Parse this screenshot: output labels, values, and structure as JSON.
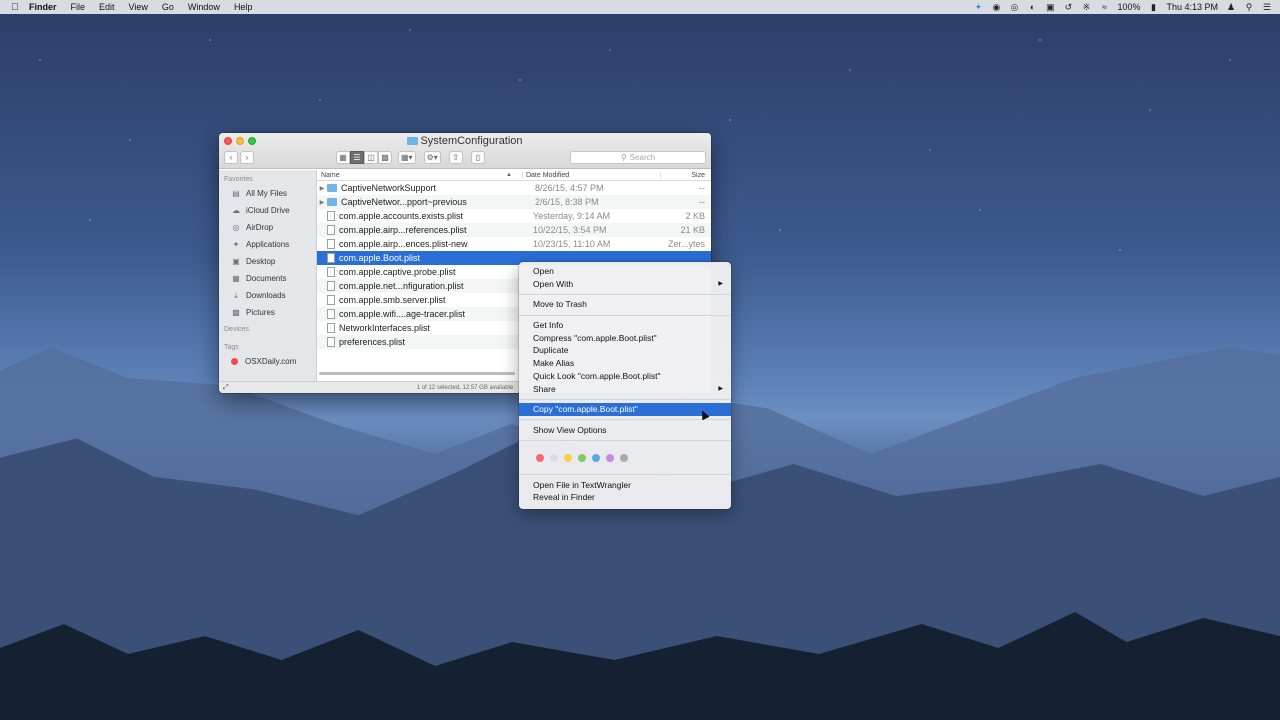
{
  "menubar": {
    "apple_icon": "apple-logo-icon",
    "items": [
      "Finder",
      "File",
      "Edit",
      "View",
      "Go",
      "Window",
      "Help"
    ],
    "status": {
      "battery": "100%",
      "clock": "Thu 4:13 PM"
    }
  },
  "window": {
    "title": "SystemConfiguration",
    "search_placeholder": "Search",
    "status_text": "1 of 12 selected, 12.57 GB available"
  },
  "sidebar": {
    "favorites_header": "Favorites",
    "favorites": [
      {
        "label": "All My Files",
        "icon": "all-files-icon"
      },
      {
        "label": "iCloud Drive",
        "icon": "cloud-icon"
      },
      {
        "label": "AirDrop",
        "icon": "airdrop-icon"
      },
      {
        "label": "Applications",
        "icon": "applications-icon"
      },
      {
        "label": "Desktop",
        "icon": "desktop-icon"
      },
      {
        "label": "Documents",
        "icon": "documents-icon"
      },
      {
        "label": "Downloads",
        "icon": "downloads-icon"
      },
      {
        "label": "Pictures",
        "icon": "pictures-icon"
      }
    ],
    "devices_header": "Devices",
    "tags_header": "Tags",
    "tags": [
      {
        "label": "OSXDaily.com",
        "color": "#ef4b4b"
      }
    ]
  },
  "list": {
    "columns": {
      "name": "Name",
      "date": "Date Modified",
      "size": "Size"
    },
    "rows": [
      {
        "name": "CaptiveNetworkSupport",
        "date": "8/26/15, 4:57 PM",
        "size": "--",
        "kind": "folder"
      },
      {
        "name": "CaptiveNetwor...pport~previous",
        "date": "2/6/15, 8:38 PM",
        "size": "--",
        "kind": "folder"
      },
      {
        "name": "com.apple.accounts.exists.plist",
        "date": "Yesterday, 9:14 AM",
        "size": "2 KB",
        "kind": "doc"
      },
      {
        "name": "com.apple.airp...references.plist",
        "date": "10/22/15, 3:54 PM",
        "size": "21 KB",
        "kind": "doc"
      },
      {
        "name": "com.apple.airp...ences.plist-new",
        "date": "10/23/15, 11:10 AM",
        "size": "Zer...ytes",
        "kind": "doc"
      },
      {
        "name": "com.apple.Boot.plist",
        "date": "",
        "size": "",
        "kind": "doc"
      },
      {
        "name": "com.apple.captive.probe.plist",
        "date": "",
        "size": "",
        "kind": "doc"
      },
      {
        "name": "com.apple.net...nfiguration.plist",
        "date": "",
        "size": "",
        "kind": "doc"
      },
      {
        "name": "com.apple.smb.server.plist",
        "date": "",
        "size": "",
        "kind": "doc"
      },
      {
        "name": "com.apple.wifi....age-tracer.plist",
        "date": "",
        "size": "",
        "kind": "doc"
      },
      {
        "name": "NetworkInterfaces.plist",
        "date": "",
        "size": "",
        "kind": "doc"
      },
      {
        "name": "preferences.plist",
        "date": "",
        "size": "",
        "kind": "doc"
      }
    ]
  },
  "context_menu": {
    "items": {
      "open": "Open",
      "open_with": "Open With",
      "move_to_trash": "Move to Trash",
      "get_info": "Get Info",
      "compress": "Compress \"com.apple.Boot.plist\"",
      "duplicate": "Duplicate",
      "make_alias": "Make Alias",
      "quick_look": "Quick Look \"com.apple.Boot.plist\"",
      "share": "Share",
      "copy": "Copy \"com.apple.Boot.plist\"",
      "show_view_options": "Show View Options",
      "open_textwrangler": "Open File in TextWrangler",
      "reveal_in_finder": "Reveal in Finder"
    },
    "tag_colors": [
      "#f36a6a",
      "#d9dce1",
      "#f6d24a",
      "#7ccd5b",
      "#5aa8ec",
      "#c58ae5",
      "#a7a9ad"
    ]
  }
}
